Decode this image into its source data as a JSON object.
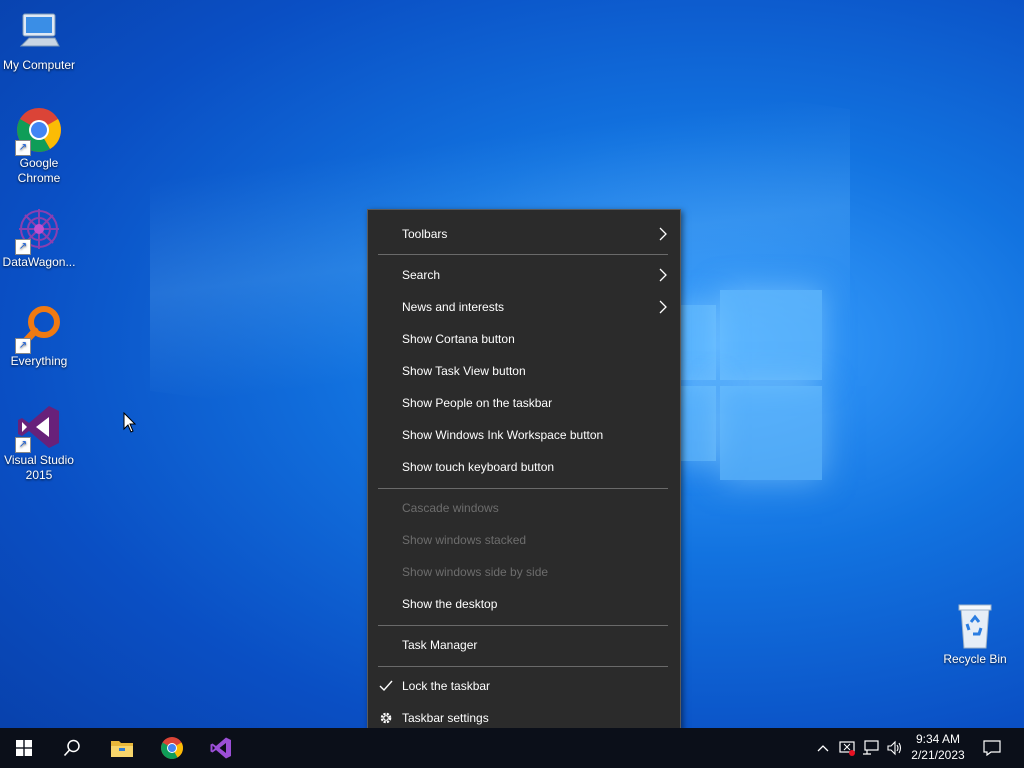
{
  "desktop": {
    "icons": [
      {
        "label": "My Computer"
      },
      {
        "label": "Google Chrome"
      },
      {
        "label": "DataWagon..."
      },
      {
        "label": "Everything"
      },
      {
        "label": "Visual Studio 2015"
      },
      {
        "label": "Recycle Bin"
      }
    ]
  },
  "context_menu": {
    "items": [
      {
        "label": "Toolbars",
        "submenu": true
      },
      {
        "label": "Search",
        "submenu": true
      },
      {
        "label": "News and interests",
        "submenu": true
      },
      {
        "label": "Show Cortana button"
      },
      {
        "label": "Show Task View button"
      },
      {
        "label": "Show People on the taskbar"
      },
      {
        "label": "Show Windows Ink Workspace button"
      },
      {
        "label": "Show touch keyboard button"
      },
      {
        "label": "Cascade windows",
        "disabled": true
      },
      {
        "label": "Show windows stacked",
        "disabled": true
      },
      {
        "label": "Show windows side by side",
        "disabled": true
      },
      {
        "label": "Show the desktop"
      },
      {
        "label": "Task Manager"
      },
      {
        "label": "Lock the taskbar",
        "checked": true
      },
      {
        "label": "Taskbar settings",
        "icon": "gear-icon"
      }
    ]
  },
  "taskbar": {
    "pinned": [
      "start-icon",
      "search-icon",
      "file-explorer-icon",
      "chrome-icon",
      "visual-studio-icon"
    ],
    "tray_icons": [
      "chevron-up-icon",
      "network-warning-icon",
      "network-icon",
      "volume-icon"
    ],
    "time": "9:34 AM",
    "date": "2/21/2023",
    "notification_icon": "notification-icon"
  },
  "colors": {
    "menu_bg": "#2b2b2b",
    "taskbar_bg": "#0b0f19",
    "desktop_accent": "#1273e0"
  }
}
